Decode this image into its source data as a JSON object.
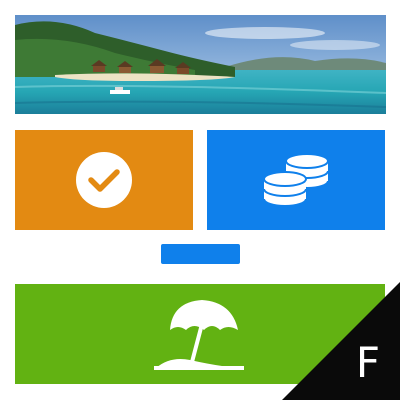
{
  "colors": {
    "orange_tile": "#E38A12",
    "blue_tile": "#0F80EB",
    "pill": "#0F80EB",
    "green_tile": "#62B212",
    "corner_badge": "#0A0A0A",
    "icon": "#FFFFFF"
  },
  "banner": {
    "image": "tropical-beach-resort-photo"
  },
  "tiles": [
    {
      "name": "check",
      "icon": "check-circle-icon"
    },
    {
      "name": "coins",
      "icon": "coin-stack-icon"
    },
    {
      "name": "beach",
      "icon": "beach-umbrella-icon"
    }
  ],
  "corner_badge": {
    "letter": "F"
  }
}
